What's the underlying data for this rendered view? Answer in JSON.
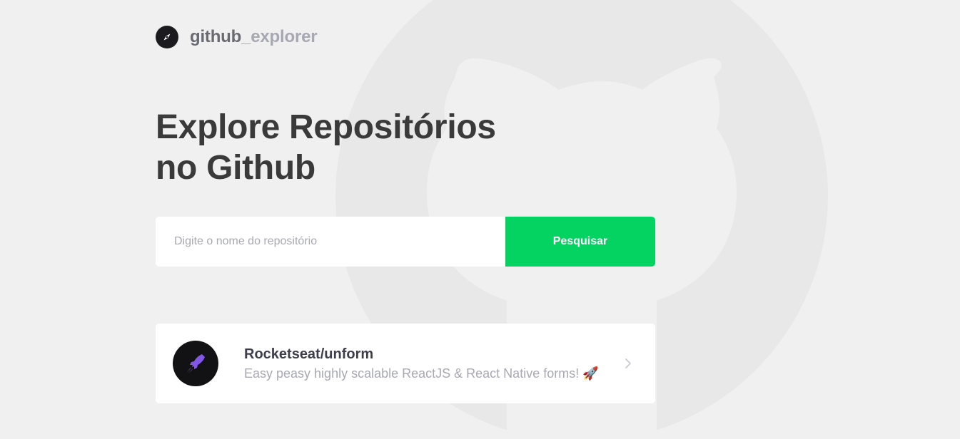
{
  "header": {
    "logo_icon": "compass-icon",
    "logo_text_primary": "github",
    "logo_text_secondary": "_explorer"
  },
  "main": {
    "title_line1": "Explore Repositórios",
    "title_line2": "no Github"
  },
  "search": {
    "placeholder": "Digite o nome do repositório",
    "value": "",
    "button_label": "Pesquisar"
  },
  "repositories": [
    {
      "name": "Rocketseat/unform",
      "description": "Easy peasy highly scalable ReactJS & React Native forms! 🚀",
      "avatar_icon": "unform-rocket-logo",
      "chevron_icon": "chevron-right-icon"
    }
  ],
  "colors": {
    "background": "#f0f0f0",
    "accent": "#04d361",
    "title": "#3a3a3a",
    "muted": "#a8a8b3"
  }
}
